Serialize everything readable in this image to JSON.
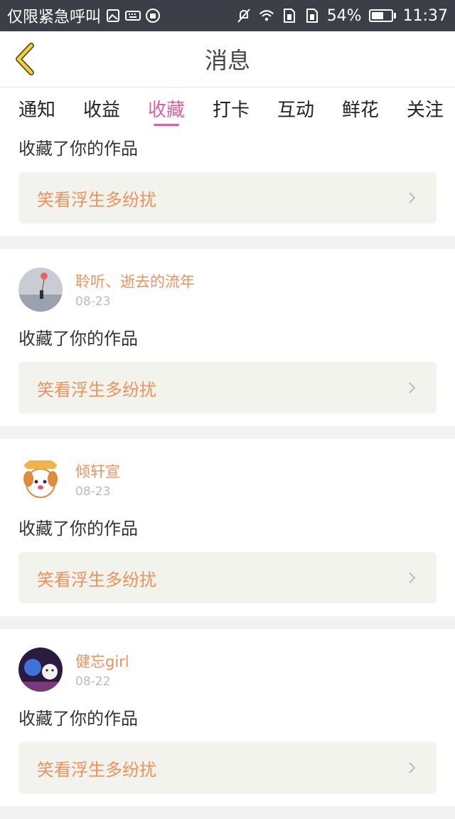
{
  "status": {
    "carrier": "仅限紧急呼叫",
    "battery": "54%",
    "time": "11:37"
  },
  "header": {
    "title": "消息"
  },
  "tabs": [
    {
      "label": "通知"
    },
    {
      "label": "收益"
    },
    {
      "label": "收藏",
      "active": true
    },
    {
      "label": "打卡"
    },
    {
      "label": "互动"
    },
    {
      "label": "鲜花"
    },
    {
      "label": "关注"
    }
  ],
  "items": [
    {
      "action": "收藏了你的作品",
      "work": "笑看浮生多纷扰"
    },
    {
      "user": "聆听、逝去的流年",
      "date": "08-23",
      "action": "收藏了你的作品",
      "work": "笑看浮生多纷扰"
    },
    {
      "user": "倾轩宣",
      "date": "08-23",
      "action": "收藏了你的作品",
      "work": "笑看浮生多纷扰"
    },
    {
      "user": "健忘girl",
      "date": "08-22",
      "action": "收藏了你的作品",
      "work": "笑看浮生多纷扰"
    }
  ],
  "colors": {
    "accent": "#e0609a",
    "name": "#f0915c"
  }
}
